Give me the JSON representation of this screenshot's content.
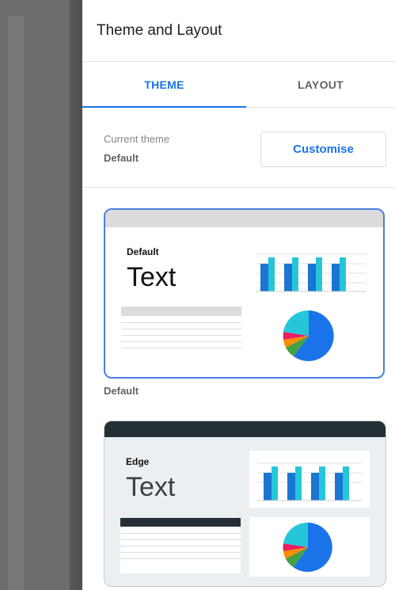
{
  "panel": {
    "title": "Theme and Layout"
  },
  "tabs": [
    {
      "label": "THEME",
      "active": true
    },
    {
      "label": "LAYOUT",
      "active": false
    }
  ],
  "current_theme": {
    "label": "Current theme",
    "value": "Default",
    "button": "Customise"
  },
  "themes": [
    {
      "name": "Default",
      "sample_label": "Default",
      "sample_text": "Text",
      "caption": "Default",
      "selected": true
    },
    {
      "name": "Edge",
      "sample_label": "Edge",
      "sample_text": "Text",
      "selected": false
    }
  ],
  "colors": {
    "accent": "#1a73e8",
    "chart_cyan": "#26c6da",
    "chart_blue": "#1976d2",
    "edge_dark": "#253035"
  }
}
